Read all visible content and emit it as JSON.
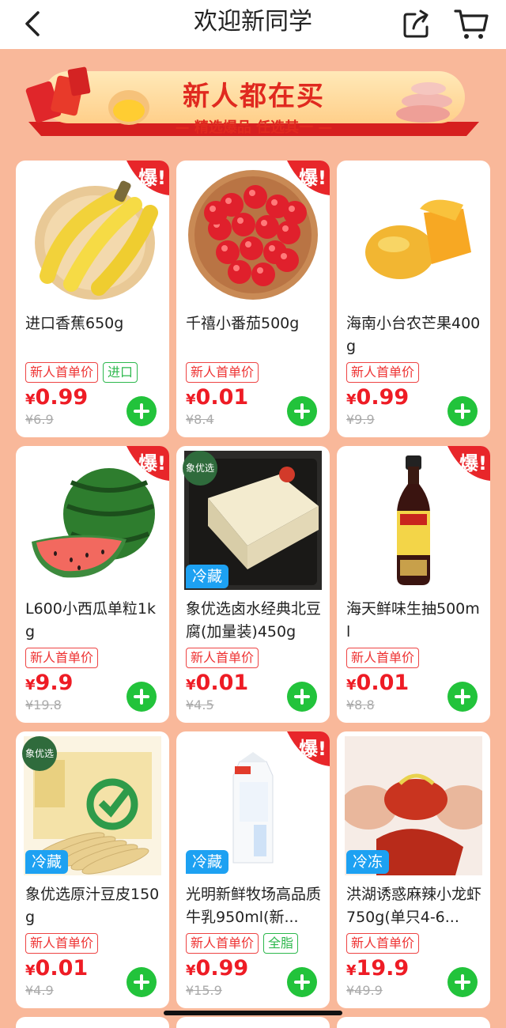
{
  "header": {
    "title": "欢迎新同学"
  },
  "banner": {
    "title": "新人都在买",
    "subtitle": "— 精选爆品 任选其一 —"
  },
  "hot_badge": "爆!",
  "products": [
    {
      "name": "进口香蕉650g",
      "tags": [
        "新人首单价"
      ],
      "extra_tag": "进口",
      "currency": "¥",
      "price": "0.99",
      "original_price": "¥6.9",
      "hot": true,
      "storage": "",
      "brand": "",
      "image": "bananas"
    },
    {
      "name": "千禧小番茄500g",
      "tags": [
        "新人首单价"
      ],
      "extra_tag": "",
      "currency": "¥",
      "price": "0.01",
      "original_price": "¥8.4",
      "hot": true,
      "storage": "",
      "brand": "",
      "image": "cherry-tomatoes"
    },
    {
      "name": "海南小台农芒果400g",
      "tags": [
        "新人首单价"
      ],
      "extra_tag": "",
      "currency": "¥",
      "price": "0.99",
      "original_price": "¥9.9",
      "hot": false,
      "storage": "",
      "brand": "",
      "image": "mangoes"
    },
    {
      "name": "L600小西瓜单粒1kg",
      "tags": [
        "新人首单价"
      ],
      "extra_tag": "",
      "currency": "¥",
      "price": "9.9",
      "original_price": "¥19.8",
      "hot": true,
      "storage": "",
      "brand": "",
      "image": "watermelon"
    },
    {
      "name": "象优选卤水经典北豆腐(加量装)450g",
      "tags": [
        "新人首单价"
      ],
      "extra_tag": "",
      "currency": "¥",
      "price": "0.01",
      "original_price": "¥4.5",
      "hot": false,
      "storage": "冷藏",
      "brand": "象优选",
      "image": "tofu"
    },
    {
      "name": "海天鲜味生抽500ml",
      "tags": [
        "新人首单价"
      ],
      "extra_tag": "",
      "currency": "¥",
      "price": "0.01",
      "original_price": "¥8.8",
      "hot": true,
      "storage": "",
      "brand": "",
      "image": "soy-sauce"
    },
    {
      "name": "象优选原汁豆皮150g",
      "tags": [
        "新人首单价"
      ],
      "extra_tag": "",
      "currency": "¥",
      "price": "0.01",
      "original_price": "¥4.9",
      "hot": false,
      "storage": "冷藏",
      "brand": "象优选",
      "image": "tofu-skin"
    },
    {
      "name": "光明新鲜牧场高品质牛乳950ml(新...",
      "tags": [
        "新人首单价"
      ],
      "extra_tag": "全脂",
      "currency": "¥",
      "price": "0.99",
      "original_price": "¥15.9",
      "hot": true,
      "storage": "冷藏",
      "brand": "",
      "image": "milk-carton"
    },
    {
      "name": "洪湖诱惑麻辣小龙虾750g(单只4-6...",
      "tags": [
        "新人首单价"
      ],
      "extra_tag": "",
      "currency": "¥",
      "price": "19.9",
      "original_price": "¥49.9",
      "hot": false,
      "storage": "冷冻",
      "brand": "",
      "image": "crayfish"
    }
  ],
  "colors": {
    "background": "#f9b89a",
    "price": "#ee1c25",
    "add_button": "#22c33b",
    "storage_badge": "#1da1f2",
    "hot_badge": "#e8262a"
  }
}
